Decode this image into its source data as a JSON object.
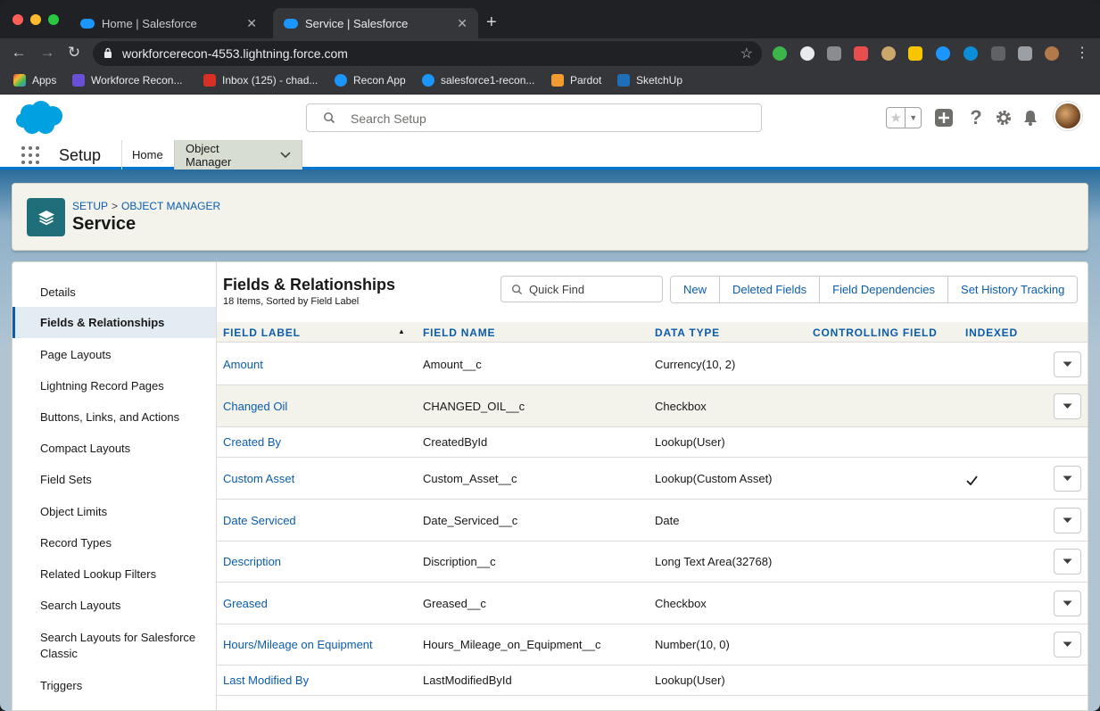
{
  "browser": {
    "tabs": [
      {
        "label": "Home | Salesforce"
      },
      {
        "label": "Service | Salesforce"
      }
    ],
    "url": "workforcerecon-4553.lightning.force.com",
    "bookmarks": [
      {
        "label": "Apps",
        "color": "#e8453c"
      },
      {
        "label": "Workforce Recon...",
        "color": "#6b4fd8"
      },
      {
        "label": "Inbox (125) - chad...",
        "color": "#d93025"
      },
      {
        "label": "Recon App",
        "color": "#1b96ff"
      },
      {
        "label": "salesforce1-recon...",
        "color": "#1b96ff"
      },
      {
        "label": "Pardot",
        "color": "#f29b30"
      },
      {
        "label": "SketchUp",
        "color": "#1d6fb8"
      }
    ]
  },
  "header": {
    "search_placeholder": "Search Setup"
  },
  "appnav": {
    "app_name": "Setup",
    "tabs": [
      {
        "label": "Home"
      },
      {
        "label": "Object Manager"
      }
    ]
  },
  "page": {
    "breadcrumb": {
      "setup": "SETUP",
      "separator": ">",
      "object_manager": "OBJECT MANAGER"
    },
    "title": "Service"
  },
  "sidebar": {
    "items": [
      {
        "label": "Details"
      },
      {
        "label": "Fields & Relationships"
      },
      {
        "label": "Page Layouts"
      },
      {
        "label": "Lightning Record Pages"
      },
      {
        "label": "Buttons, Links, and Actions"
      },
      {
        "label": "Compact Layouts"
      },
      {
        "label": "Field Sets"
      },
      {
        "label": "Object Limits"
      },
      {
        "label": "Record Types"
      },
      {
        "label": "Related Lookup Filters"
      },
      {
        "label": "Search Layouts"
      },
      {
        "label": "Search Layouts for Salesforce Classic"
      },
      {
        "label": "Triggers"
      }
    ]
  },
  "main": {
    "title": "Fields & Relationships",
    "subtitle": "18 Items, Sorted by Field Label",
    "quick_find_placeholder": "Quick Find",
    "buttons": [
      {
        "label": "New"
      },
      {
        "label": "Deleted Fields"
      },
      {
        "label": "Field Dependencies"
      },
      {
        "label": "Set History Tracking"
      }
    ],
    "columns": [
      "FIELD LABEL",
      "FIELD NAME",
      "DATA TYPE",
      "CONTROLLING FIELD",
      "INDEXED"
    ],
    "rows": [
      {
        "label": "Amount",
        "name": "Amount__c",
        "type": "Currency(10, 2)",
        "controlling": "",
        "indexed": false,
        "has_menu": true
      },
      {
        "label": "Changed Oil",
        "name": "CHANGED_OIL__c",
        "type": "Checkbox",
        "controlling": "",
        "indexed": false,
        "has_menu": true
      },
      {
        "label": "Created By",
        "name": "CreatedById",
        "type": "Lookup(User)",
        "controlling": "",
        "indexed": false,
        "has_menu": false
      },
      {
        "label": "Custom Asset",
        "name": "Custom_Asset__c",
        "type": "Lookup(Custom Asset)",
        "controlling": "",
        "indexed": true,
        "has_menu": true
      },
      {
        "label": "Date Serviced",
        "name": "Date_Serviced__c",
        "type": "Date",
        "controlling": "",
        "indexed": false,
        "has_menu": true
      },
      {
        "label": "Description",
        "name": "Discription__c",
        "type": "Long Text Area(32768)",
        "controlling": "",
        "indexed": false,
        "has_menu": true
      },
      {
        "label": "Greased",
        "name": "Greased__c",
        "type": "Checkbox",
        "controlling": "",
        "indexed": false,
        "has_menu": true
      },
      {
        "label": "Hours/Mileage on Equipment",
        "name": "Hours_Mileage_on_Equipment__c",
        "type": "Number(10, 0)",
        "controlling": "",
        "indexed": false,
        "has_menu": true
      },
      {
        "label": "Last Modified By",
        "name": "LastModifiedById",
        "type": "Lookup(User)",
        "controlling": "",
        "indexed": false,
        "has_menu": false
      }
    ]
  }
}
